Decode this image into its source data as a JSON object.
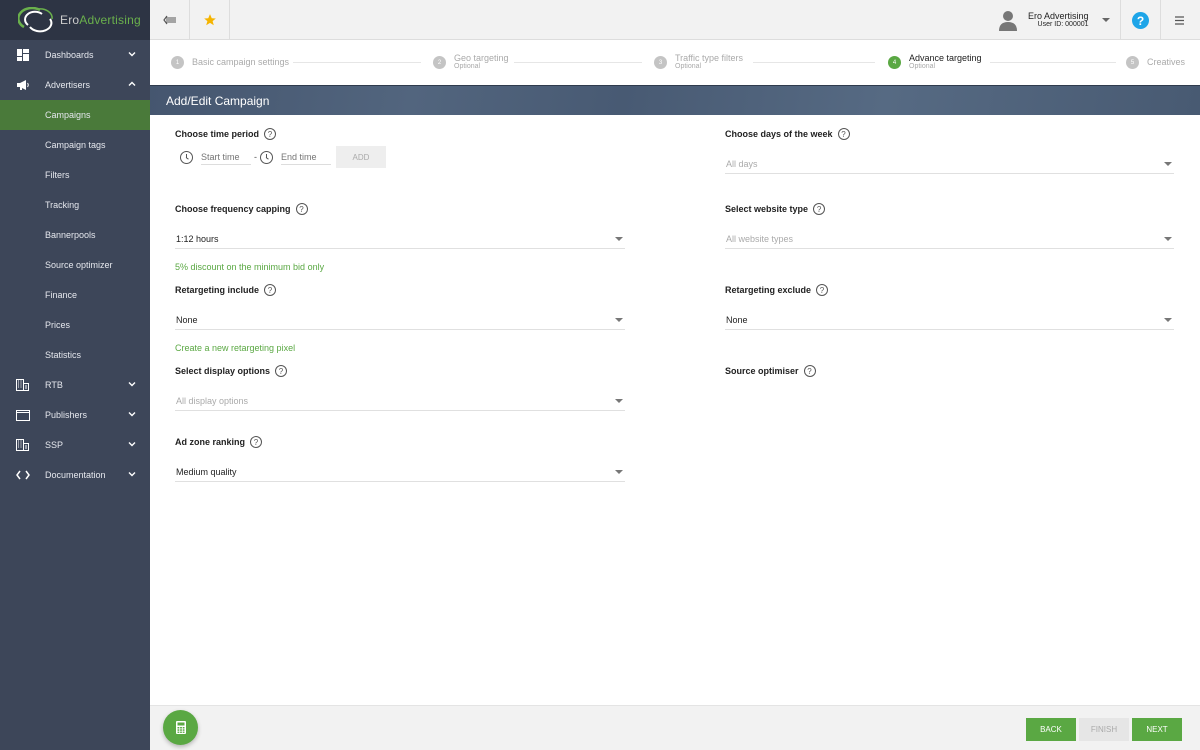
{
  "brand": {
    "name_part1": "Ero",
    "name_part2": "Advertising",
    "accent_color": "#5aa843"
  },
  "sidebar": {
    "items": [
      {
        "label": "Dashboards",
        "icon": "dashboard-icon",
        "expandable": true,
        "expanded": false
      },
      {
        "label": "Advertisers",
        "icon": "megaphone-icon",
        "expandable": true,
        "expanded": true
      },
      {
        "label": "Campaigns",
        "sub": true,
        "active": true
      },
      {
        "label": "Campaign tags",
        "sub": true
      },
      {
        "label": "Filters",
        "sub": true
      },
      {
        "label": "Tracking",
        "sub": true
      },
      {
        "label": "Bannerpools",
        "sub": true
      },
      {
        "label": "Source optimizer",
        "sub": true
      },
      {
        "label": "Finance",
        "sub": true
      },
      {
        "label": "Prices",
        "sub": true
      },
      {
        "label": "Statistics",
        "sub": true
      },
      {
        "label": "RTB",
        "icon": "building-icon",
        "expandable": true,
        "expanded": false
      },
      {
        "label": "Publishers",
        "icon": "window-icon",
        "expandable": true,
        "expanded": false
      },
      {
        "label": "SSP",
        "icon": "building-icon",
        "expandable": true,
        "expanded": false
      },
      {
        "label": "Documentation",
        "icon": "code-icon",
        "expandable": true,
        "expanded": false
      }
    ]
  },
  "header": {
    "user_name": "Ero Advertising",
    "user_id": "User ID: 000001"
  },
  "stepper": {
    "steps": [
      {
        "num": "1",
        "title": "Basic campaign settings",
        "sub": ""
      },
      {
        "num": "2",
        "title": "Geo targeting",
        "sub": "Optional"
      },
      {
        "num": "3",
        "title": "Traffic type filters",
        "sub": "Optional"
      },
      {
        "num": "4",
        "title": "Advance targeting",
        "sub": "Optional",
        "active": true
      },
      {
        "num": "5",
        "title": "Creatives",
        "sub": ""
      }
    ]
  },
  "page_title": "Add/Edit Campaign",
  "form": {
    "time_period": {
      "label": "Choose time period",
      "start_placeholder": "Start time",
      "separator": "-",
      "end_placeholder": "End time",
      "add_label": "ADD"
    },
    "frequency": {
      "label": "Choose frequency capping",
      "value": "1:12 hours",
      "note": "5% discount on the minimum bid only"
    },
    "retargeting_include": {
      "label": "Retargeting include",
      "value": "None",
      "link": "Create a new retargeting pixel"
    },
    "display_options": {
      "label": "Select display options",
      "placeholder": "All display options"
    },
    "ad_zone_ranking": {
      "label": "Ad zone ranking",
      "value": "Medium quality"
    },
    "days_of_week": {
      "label": "Choose days of the week",
      "placeholder": "All days"
    },
    "website_type": {
      "label": "Select website type",
      "placeholder": "All website types"
    },
    "retargeting_exclude": {
      "label": "Retargeting exclude",
      "value": "None"
    },
    "source_optimiser": {
      "label": "Source optimiser"
    }
  },
  "footer": {
    "back": "BACK",
    "finish": "FINISH",
    "next": "NEXT"
  }
}
